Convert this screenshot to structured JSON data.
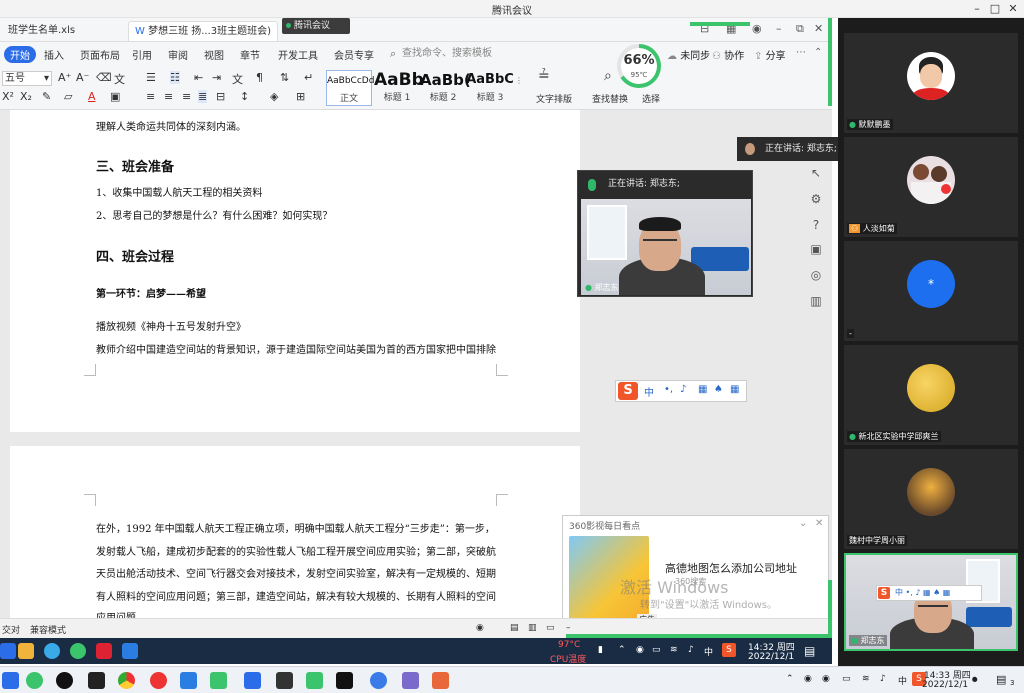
{
  "window": {
    "title": "腾讯会议",
    "meeting_badge": "腾讯会议"
  },
  "wps": {
    "tabs": [
      {
        "label": "班学生名单.xls"
      },
      {
        "label": "梦想三班 扬...3班主题班会)"
      }
    ],
    "menu": [
      "开始",
      "插入",
      "页面布局",
      "引用",
      "审阅",
      "视图",
      "章节",
      "开发工具",
      "会员专享"
    ],
    "search_placeholder": "查找命令、搜索模板",
    "right_actions": {
      "unsync": "未同步",
      "collab": "协作",
      "share": "分享"
    },
    "font_size_value": "五号",
    "styles": [
      {
        "sample": "AaBbCcDd",
        "name": "正文"
      },
      {
        "sample": "AaBb",
        "name": "标题 1"
      },
      {
        "sample": "AaBb(",
        "name": "标题 2"
      },
      {
        "sample": "AaBbC",
        "name": "标题 3"
      }
    ],
    "text_layout": "文字排版",
    "find_replace": "查找替换",
    "select": "选择",
    "status": {
      "left": "交对",
      "compat": "兼容模式"
    }
  },
  "cpu": {
    "percent": "66%",
    "temp": "95℃",
    "percent_value": 66
  },
  "document": {
    "page1": [
      {
        "text": "理解人类命运共同体的深刻内涵。",
        "style": "p"
      },
      {
        "text": "三、班会准备",
        "style": "h2"
      },
      {
        "text": "1、收集中国载人航天工程的相关资料",
        "style": "p"
      },
      {
        "text": "2、思考自己的梦想是什么？有什么困难？如何实现？",
        "style": "p"
      },
      {
        "text": "四、班会过程",
        "style": "h2"
      },
      {
        "text": "第一环节：启梦——希望",
        "style": "p bold"
      },
      {
        "text": "播放视频《神舟十五号发射升空》",
        "style": "p"
      },
      {
        "text": "教师介绍中国建造空间站的背景知识，源于建造国际空间站美国为首的西方国家把中国排除",
        "style": "p"
      }
    ],
    "page2": [
      "在外，1992 年中国载人航天工程正确立项，明确中国载人航天工程分“三步走”：第一步，",
      "发射载人飞船，建成初步配套的的实验性载人飞船工程开展空间应用实验；第二部，突破航",
      "天员出舱活动技术、空间飞行器交会对接技术，发射空间实验室，解决有一定规模的、短期",
      "有人照料的空间应用问题；第三部，建造空间站，解决有较大规模的、长期有人照料的空间",
      "应用问题。"
    ]
  },
  "speaker": {
    "popup_title": "正在讲话: 郑志东;",
    "tip": "正在讲话: 郑志东;",
    "name": "郑志东"
  },
  "ime": {
    "logo": "S",
    "items": [
      "中",
      "•,",
      "🎤",
      "▦",
      "👕",
      "▦"
    ]
  },
  "news": {
    "header": "360影视每日看点",
    "title": "高德地图怎么添加公司地址",
    "source": "360搜索",
    "ad": "广告",
    "watermark": "激活 Windows",
    "watermark_sub": "转到\"设置\"以激活 Windows。"
  },
  "remote_taskbar": {
    "temp": "97°C",
    "cpu_label": "CPU温度",
    "ime": "中",
    "time": "14:32 周四",
    "date": "2022/12/1"
  },
  "participants": [
    {
      "label": "默默鹏墨"
    },
    {
      "label": "人淡如菊"
    },
    {
      "label": "*"
    },
    {
      "label": "-"
    },
    {
      "label": "新北区实验中学邱爽兰"
    },
    {
      "label": "魏村中学周小丽"
    },
    {
      "label": "郑志东"
    }
  ],
  "local_taskbar": {
    "ime": "中",
    "time": "14:33 周四",
    "date": "2022/12/1",
    "notify_count": "3"
  }
}
